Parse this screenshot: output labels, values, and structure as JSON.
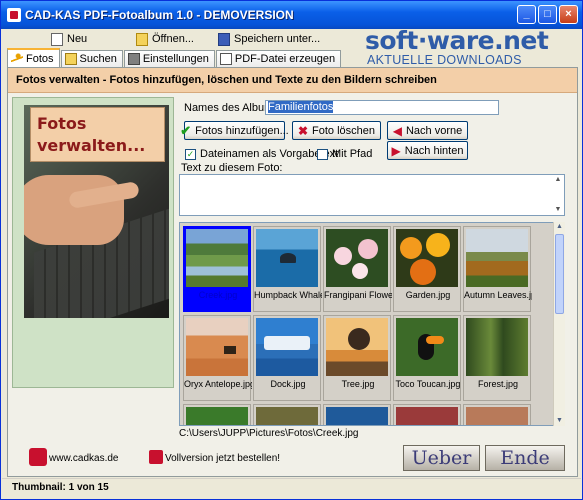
{
  "window": {
    "title": "CAD-KAS PDF-Fotoalbum 1.0 - DEMOVERSION"
  },
  "menu": {
    "items": [
      "Neu",
      "Öffnen...",
      "Speichern unter..."
    ]
  },
  "brand": {
    "logo": "soft·ware.net",
    "tagline": "AKTUELLE DOWNLOADS"
  },
  "tabs": [
    "Fotos",
    "Suchen",
    "Einstellungen",
    "PDF-Datei erzeugen"
  ],
  "header": {
    "text": "Fotos verwalten - Fotos hinzufügen, löschen und Texte zu den Bildern schreiben"
  },
  "left_image": {
    "caption": "Fotos verwalten..."
  },
  "form": {
    "album_label": "Names des Albums:",
    "album_value": "Familienfotos",
    "btn_add": "Fotos hinzufügen...",
    "btn_delete": "Foto löschen",
    "btn_forward": "Nach vorne",
    "btn_back": "Nach hinten",
    "chk_filename_label": "Dateinamen als Vorgabetext",
    "chk_filename_checked": true,
    "chk_path_label": "Mit Pfad",
    "chk_path_checked": false,
    "text_label": "Text zu diesem Foto:"
  },
  "thumbnails": [
    {
      "caption": "Creek.jpg",
      "selected": true
    },
    {
      "caption": "Humpback Whale",
      "selected": false
    },
    {
      "caption": "Frangipani Flower",
      "selected": false
    },
    {
      "caption": "Garden.jpg",
      "selected": false
    },
    {
      "caption": "Autumn Leaves.jp",
      "selected": false
    },
    {
      "caption": "Oryx Antelope.jpg",
      "selected": false
    },
    {
      "caption": "Dock.jpg",
      "selected": false
    },
    {
      "caption": "Tree.jpg",
      "selected": false
    },
    {
      "caption": "Toco Toucan.jpg",
      "selected": false
    },
    {
      "caption": "Forest.jpg",
      "selected": false
    }
  ],
  "path": "C:\\Users\\JUPP\\Pictures\\Fotos\\Creek.jpg",
  "footer": {
    "website": "www.cadkas.de",
    "order": "Vollversion jetzt bestellen!",
    "btn_about": "Ueber",
    "btn_end": "Ende"
  },
  "status": "Thumbnail: 1 von 15"
}
